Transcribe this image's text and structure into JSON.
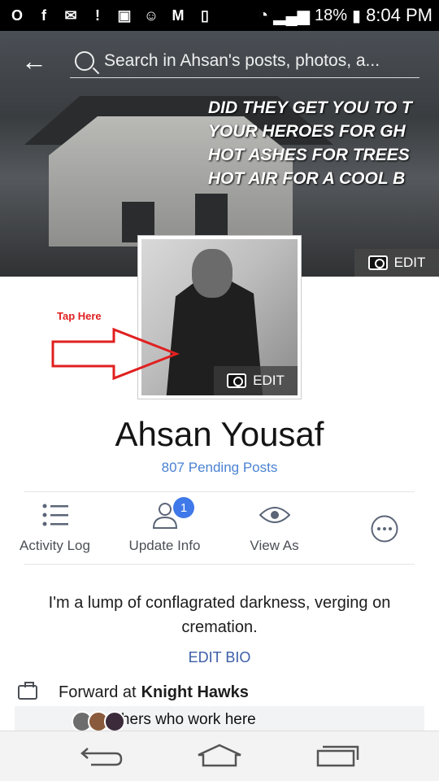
{
  "status_bar": {
    "battery": "18%",
    "time": "8:04 PM",
    "icons": [
      "opera-icon",
      "facebook-icon",
      "messenger-icon",
      "alert-icon",
      "gallery-icon",
      "bear-icon",
      "gmail-icon",
      "vibrate-icon",
      "wifi-icon",
      "signal-icon",
      "battery-icon"
    ]
  },
  "header": {
    "back_icon": "back-arrow-icon",
    "search_placeholder": "Search in Ahsan's posts, photos, a..."
  },
  "cover": {
    "quote_lines": [
      "DID THEY GET YOU TO T",
      "YOUR HEROES FOR GH",
      "HOT ASHES FOR TREES",
      "HOT AIR FOR A COOL B"
    ],
    "edit_label": "EDIT"
  },
  "profile": {
    "edit_label": "EDIT",
    "annotation": "Tap Here",
    "name": "Ahsan Yousaf",
    "pending_posts": "807 Pending Posts"
  },
  "actions": [
    {
      "label": "Activity Log",
      "icon": "list-icon"
    },
    {
      "label": "Update Info",
      "icon": "person-icon",
      "badge": "1"
    },
    {
      "label": "View As",
      "icon": "eye-icon"
    },
    {
      "label": "",
      "icon": "more-icon"
    }
  ],
  "bio": {
    "text": "I'm a lump of conflagrated darkness, verging on cremation.",
    "edit_label": "EDIT BIO"
  },
  "work": {
    "prefix": "Forward at",
    "company": "Knight Hawks",
    "others_label": "See others who work here"
  },
  "colors": {
    "accent": "#4a82d2",
    "link": "#3b5ea8",
    "badge": "#3f79e9",
    "annotation": "#e02020"
  }
}
